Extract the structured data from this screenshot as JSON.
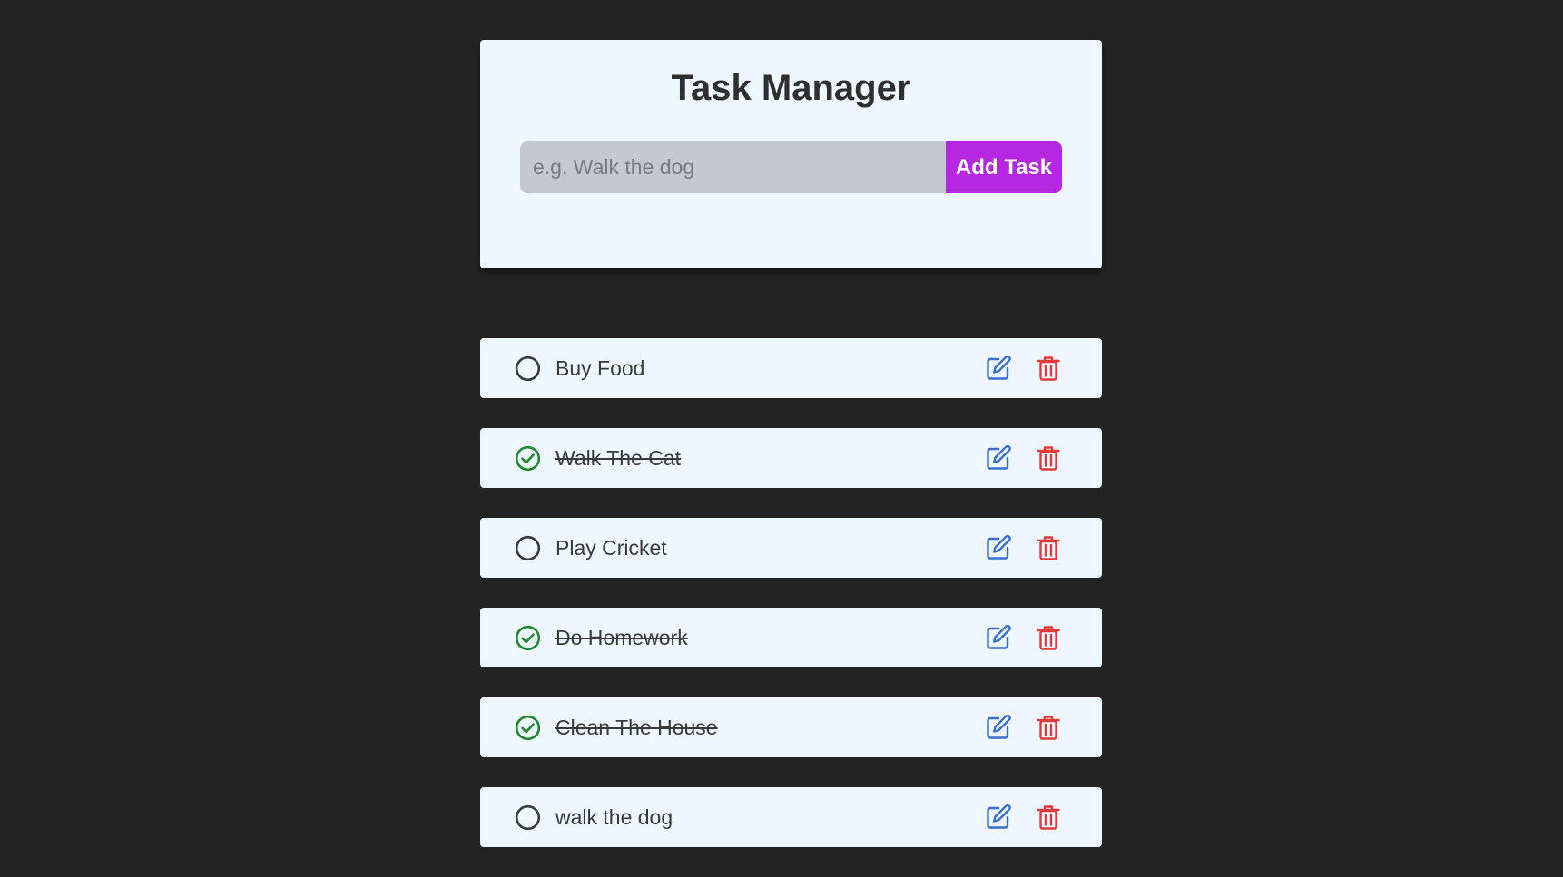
{
  "app": {
    "title": "Task Manager"
  },
  "add_form": {
    "placeholder": "e.g. Walk the dog",
    "value": "",
    "button_label": "Add Task"
  },
  "tasks": [
    {
      "text": "Buy Food",
      "completed": false
    },
    {
      "text": "Walk The Cat",
      "completed": true
    },
    {
      "text": "Play Cricket",
      "completed": false
    },
    {
      "text": "Do Homework",
      "completed": true
    },
    {
      "text": "Clean The House",
      "completed": true
    },
    {
      "text": "walk the dog",
      "completed": false
    }
  ],
  "icons": {
    "incomplete": "circle-icon",
    "complete": "check-circle-icon",
    "edit": "edit-icon",
    "delete": "trash-icon"
  },
  "colors": {
    "background": "#232323",
    "card": "#eef6ff",
    "accent": "#b627e2",
    "input_bg": "#c5c9cf",
    "complete": "#1f8a2c",
    "incomplete": "#3a3a3a",
    "edit": "#3a6fd0",
    "delete": "#e03b3b"
  }
}
